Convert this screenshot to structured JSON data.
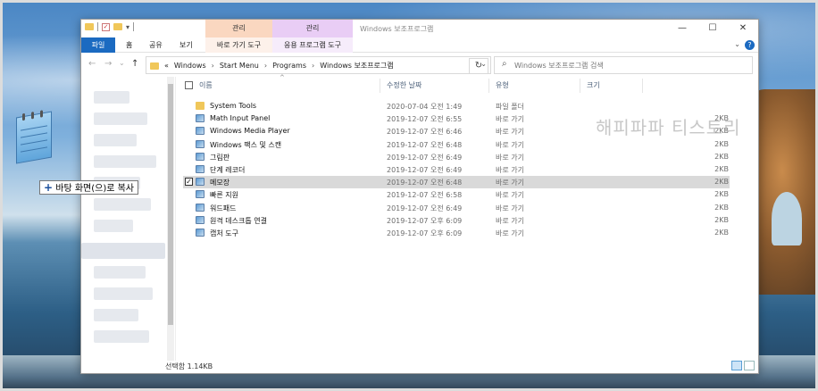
{
  "window": {
    "title": "Windows 보조프로그램",
    "context_tab_1": "관리",
    "context_tab_2": "관리",
    "controls": {
      "minimize": "—",
      "maximize": "☐",
      "close": "✕"
    }
  },
  "ribbon": {
    "tabs": [
      "파일",
      "홈",
      "공유",
      "보기"
    ],
    "context_subtab_1": "바로 가기 도구",
    "context_subtab_2": "응용 프로그램 도구",
    "help": "?",
    "collapse": "⌄"
  },
  "address": {
    "crumbs": [
      "«",
      "Windows",
      "Start Menu",
      "Programs",
      "Windows 보조프로그램"
    ],
    "search_placeholder": "Windows 보조프로그램 검색"
  },
  "columns": {
    "name": "이름",
    "date": "수정한 날짜",
    "type": "유형",
    "size": "크기"
  },
  "files": [
    {
      "name": "System Tools",
      "date": "2020-07-04 오전 1:49",
      "type": "파일 폴더",
      "size": "",
      "kind": "folder"
    },
    {
      "name": "Math Input Panel",
      "date": "2019-12-07 오전 6:55",
      "type": "바로 가기",
      "size": "2KB",
      "kind": "shortcut"
    },
    {
      "name": "Windows Media Player",
      "date": "2019-12-07 오전 6:46",
      "type": "바로 가기",
      "size": "2KB",
      "kind": "shortcut"
    },
    {
      "name": "Windows 팩스 및 스캔",
      "date": "2019-12-07 오전 6:48",
      "type": "바로 가기",
      "size": "2KB",
      "kind": "shortcut"
    },
    {
      "name": "그림판",
      "date": "2019-12-07 오전 6:49",
      "type": "바로 가기",
      "size": "2KB",
      "kind": "shortcut"
    },
    {
      "name": "단계 레코더",
      "date": "2019-12-07 오전 6:49",
      "type": "바로 가기",
      "size": "2KB",
      "kind": "shortcut"
    },
    {
      "name": "메모장",
      "date": "2019-12-07 오전 6:48",
      "type": "바로 가기",
      "size": "2KB",
      "kind": "shortcut",
      "selected": true
    },
    {
      "name": "빠른 지원",
      "date": "2019-12-07 오전 6:58",
      "type": "바로 가기",
      "size": "2KB",
      "kind": "shortcut"
    },
    {
      "name": "워드패드",
      "date": "2019-12-07 오전 6:49",
      "type": "바로 가기",
      "size": "2KB",
      "kind": "shortcut"
    },
    {
      "name": "원격 데스크톱 연결",
      "date": "2019-12-07 오후 6:09",
      "type": "바로 가기",
      "size": "2KB",
      "kind": "shortcut"
    },
    {
      "name": "캡처 도구",
      "date": "2019-12-07 오후 6:09",
      "type": "바로 가기",
      "size": "2KB",
      "kind": "shortcut"
    }
  ],
  "status": {
    "text": "선택함 1.14KB"
  },
  "drag": {
    "tooltip_plus": "+",
    "tooltip_text": "바탕 화면(으)로 복사"
  },
  "watermark": "해피파파 티스토리",
  "colors": {
    "accent": "#1b6ac1",
    "selected_row": "#d9d9d9",
    "ctx1": "#fad7c0",
    "ctx2": "#e9cdf5"
  }
}
